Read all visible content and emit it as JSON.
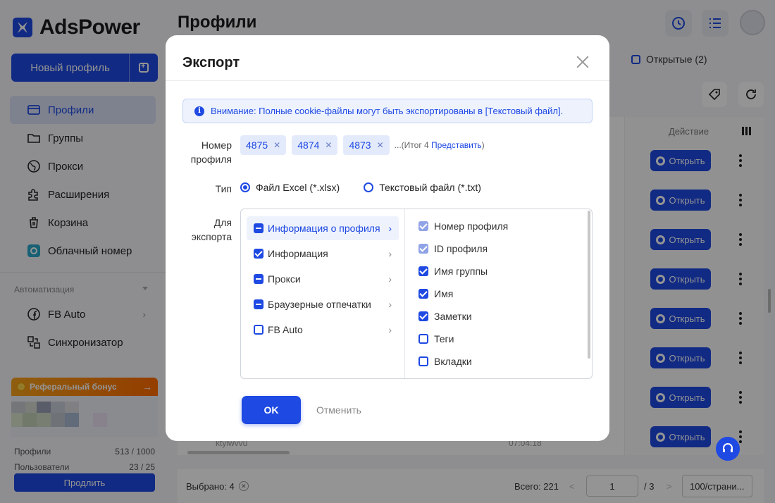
{
  "app": {
    "name": "AdsPower"
  },
  "sidebar": {
    "new_profile": "Новый профиль",
    "items": [
      {
        "label": "Профили",
        "icon": "profile-card-icon",
        "active": true
      },
      {
        "label": "Группы",
        "icon": "folder-icon"
      },
      {
        "label": "Прокси",
        "icon": "globe-icon"
      },
      {
        "label": "Расширения",
        "icon": "puzzle-icon"
      },
      {
        "label": "Корзина",
        "icon": "trash-icon"
      },
      {
        "label": "Облачный номер",
        "icon": "cloud-phone-icon"
      }
    ],
    "automation_label": "Автоматизация",
    "automation_items": [
      {
        "label": "FB Auto",
        "icon": "facebook-icon"
      },
      {
        "label": "Синхронизатор",
        "icon": "sync-icon"
      }
    ],
    "referral": "Реферальный бонус",
    "stats": [
      {
        "label": "Профили",
        "value": "513 / 1000"
      },
      {
        "label": "Пользователи",
        "value": "23 / 25"
      }
    ],
    "extend_button": "Продлить"
  },
  "main": {
    "title": "Профили",
    "opened_filter": "Открытые (2)",
    "action_header": "Действие",
    "open_button": "Открыть",
    "row_text": "ktylwvvu",
    "row_time": "07:04:18"
  },
  "footer": {
    "selected": "Выбрано: 4",
    "total": "Всего: 221",
    "prev": "<",
    "page": "1",
    "pages": "/ 3",
    "next": ">",
    "per_page": "100/страни..."
  },
  "modal": {
    "title": "Экспорт",
    "notice": "Внимание: Полные cookie-файлы могут быть экспортированы в [Текстовый файл].",
    "profile_number_label_1": "Номер",
    "profile_number_label_2": "профиля",
    "tags": [
      "4875",
      "4874",
      "4873"
    ],
    "total_note": "...(Итог 4 ",
    "total_link": "Представить",
    "total_close": ")",
    "type_label": "Тип",
    "type_options": [
      {
        "label": "Файл Excel (*.xlsx)",
        "selected": true
      },
      {
        "label": "Текстовый файл (*.txt)",
        "selected": false
      }
    ],
    "export_label_1": "Для",
    "export_label_2": "экспорта",
    "categories": [
      {
        "label": "Информация о профиля",
        "state": "partial",
        "active": true
      },
      {
        "label": "Информация",
        "state": "checked"
      },
      {
        "label": "Прокси",
        "state": "partial"
      },
      {
        "label": "Браузерные отпечатки",
        "state": "partial"
      },
      {
        "label": "FB Auto",
        "state": "empty"
      }
    ],
    "fields": [
      {
        "label": "Номер профиля",
        "state": "disabled"
      },
      {
        "label": "ID профиля",
        "state": "disabled"
      },
      {
        "label": "Имя группы",
        "state": "checked"
      },
      {
        "label": "Имя",
        "state": "checked"
      },
      {
        "label": "Заметки",
        "state": "checked"
      },
      {
        "label": "Теги",
        "state": "empty"
      },
      {
        "label": "Вкладки",
        "state": "empty"
      }
    ],
    "ok": "OK",
    "cancel": "Отменить"
  }
}
